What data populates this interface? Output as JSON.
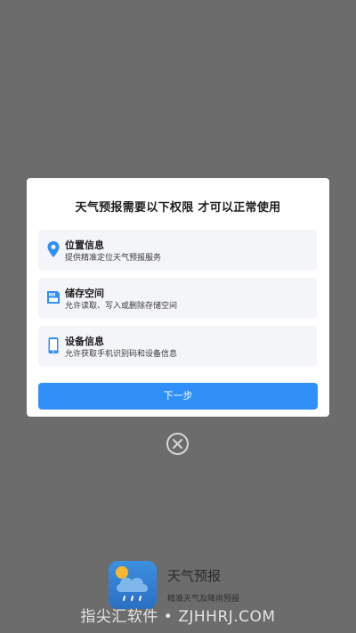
{
  "dialog": {
    "title": "天气预报需要以下权限 才可以正常使用",
    "permissions": [
      {
        "title": "位置信息",
        "description": "提供精准定位天气预报服务",
        "icon": "location-pin-icon"
      },
      {
        "title": "储存空间",
        "description": "允许读取、写入或删除存储空间",
        "icon": "sd-card-icon"
      },
      {
        "title": "设备信息",
        "description": "允许获取手机识别码和设备信息",
        "icon": "phone-icon"
      }
    ],
    "next_label": "下一步"
  },
  "close_icon": "close-circle-icon",
  "app": {
    "name": "天气预报",
    "slogan": "精准天气及降雨预报",
    "logo_icon": "cloud-rain-icon"
  },
  "watermark": "指尖汇软件 • ZJHHRJ.COM",
  "colors": {
    "accent": "#2f8ff7",
    "icon": "#2f8ff7",
    "overlay": "#6c6c6c",
    "item_bg": "#f4f5f8"
  }
}
